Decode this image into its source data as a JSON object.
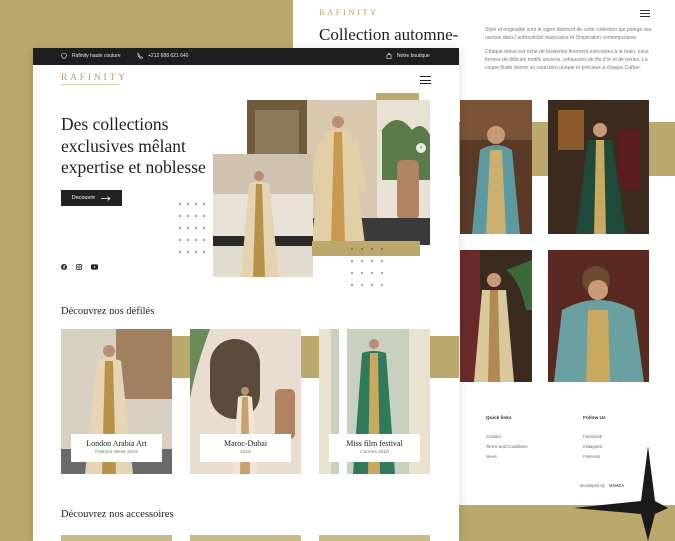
{
  "colors": {
    "gold": "#bba86d",
    "dark": "#1e1e1e",
    "white": "#ffffff"
  },
  "back_page": {
    "logo": "RAFINITY",
    "menu_icon": "hamburger-icon",
    "title": "Collection automne-",
    "description": [
      "Style et originalité sont le signe distinctif de cette collection qui plonge ses racines dans l'authenticité marocaine et l'inspiration contemporaine.",
      "Chaque tenue est riche de broderies finement exécutées à la main, sous formes de délicats motifs anciens, rehaussés de fils d'or et de perles. La coupe fluide donne un caractère unique et précieux à chaque Caftan."
    ],
    "footer": {
      "quick_links_heading": "Quick links",
      "quick_links": [
        "Contact",
        "Terms and Conditions",
        "News"
      ],
      "follow_heading": "Follow Us",
      "follow_links": [
        "Facebook",
        "Instagram",
        "Pinterest"
      ],
      "developed_by": "developed by",
      "developer": "HAMZA"
    }
  },
  "front_page": {
    "topbar": {
      "location_icon": "location-pin-icon",
      "location_text": "Rafinity haute couture",
      "phone_icon": "phone-icon",
      "phone_text": "+212 688 621 640",
      "shop_icon": "shopping-bag-icon",
      "shop_text": "Notre boutique"
    },
    "logo": "RAFINITY",
    "hero": {
      "title": "Des collections exclusives mêlant expertise et noblesse",
      "button_label": "Decouvrir",
      "button_icon": "arrow-right-icon",
      "carousel_arrow": "›",
      "social_icons": [
        "facebook-icon",
        "instagram-icon",
        "youtube-icon"
      ]
    },
    "defiles": {
      "heading": "Découvrez nos défilés",
      "cards": [
        {
          "title": "London Arabia Art",
          "subtitle": "Fashion Week 2019"
        },
        {
          "title": "Maroc-Dubai",
          "subtitle": "2019"
        },
        {
          "title": "Miss film festival",
          "subtitle": "Cannes 2018"
        }
      ]
    },
    "accessoires": {
      "heading": "Découvrez nos accessoires"
    }
  }
}
